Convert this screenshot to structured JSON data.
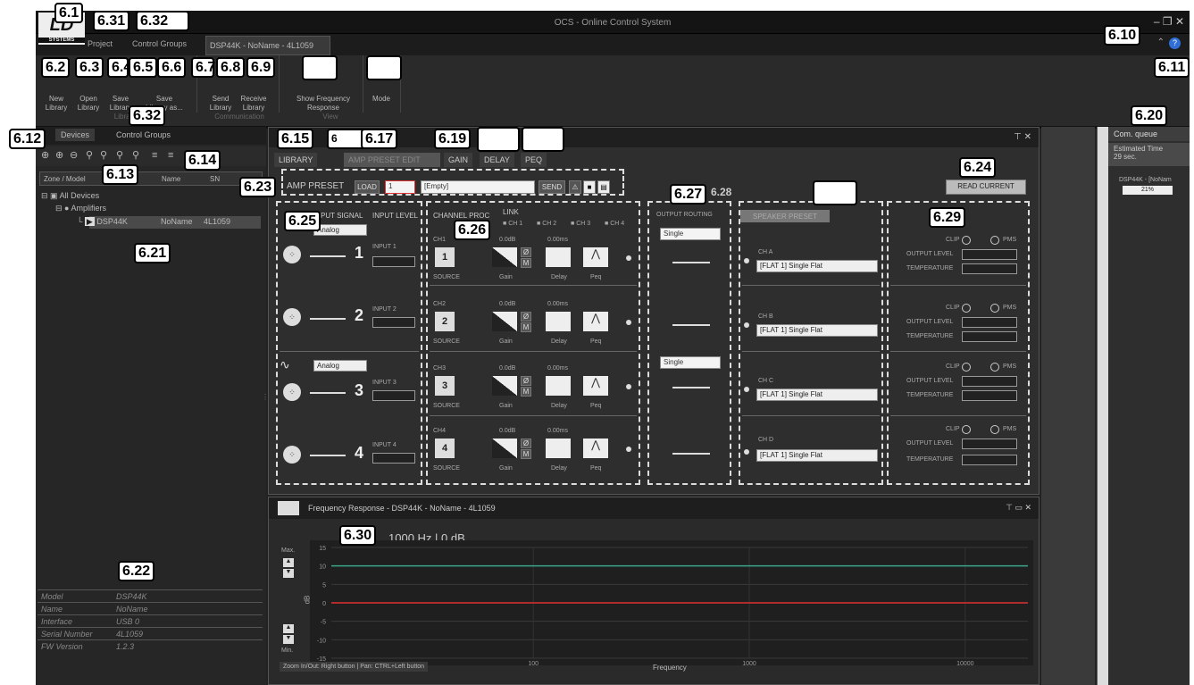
{
  "window": {
    "title": "OCS - Online Control System",
    "logo": "LD",
    "logo_sub": "SYSTEMS"
  },
  "menu": {
    "project": "Project",
    "control_groups": "Control Groups",
    "doc_tab": "DSP44K - NoName - 4L1059"
  },
  "ribbon": {
    "new_library": "New\nLibrary",
    "open_library": "Open\nLibrary",
    "save_library": "Save\nLibrary",
    "save_library_as": "Save\nLibrary as...",
    "send_library": "Send\nLibrary",
    "receive_library": "Receive\nLibrary",
    "show_freq": "Show Frequency\nResponse",
    "mode": "Mode",
    "group_library": "Library",
    "group_comm": "Communication",
    "group_view": "View"
  },
  "callouts": {
    "c61": "6.1",
    "c631": "6.31",
    "c632": "6.32",
    "c62": "6.2",
    "c63": "6.3",
    "c64": "6.4",
    "c65": "6.5",
    "c66": "6.6",
    "c67": "6.7",
    "c68": "6.8",
    "c69": "6.9",
    "c610": "6.10",
    "c611": "6.11",
    "c612": "6.12",
    "c613": "6.13",
    "c614": "6.14",
    "c632b": "6.32",
    "c615": "6.15",
    "c616": "6",
    "c617": "6.17",
    "c619": "6.19",
    "c620": "6.20",
    "c621": "6.21",
    "c622": "6.22",
    "c623": "6.23",
    "c624": "6.24",
    "c625": "6.25",
    "c626": "6.26",
    "c627": "6.27",
    "c628": "6.28",
    "c629": "6.29",
    "c630": "6.30"
  },
  "left": {
    "tab_devices": "Devices",
    "tab_control_groups": "Control Groups",
    "col_zone": "Zone / Model",
    "col_name": "Name",
    "col_sn": "SN",
    "tree_all": "All Devices",
    "tree_amps": "Amplifiers",
    "tree_dev_model": "DSP44K",
    "tree_dev_name": "NoName",
    "tree_dev_sn": "4L1059",
    "props": [
      {
        "k": "Model",
        "v": "DSP44K"
      },
      {
        "k": "Name",
        "v": "NoName"
      },
      {
        "k": "Interface",
        "v": "USB 0"
      },
      {
        "k": "Serial Number",
        "v": "4L1059"
      },
      {
        "k": "FW Version",
        "v": "1.2.3"
      }
    ]
  },
  "main": {
    "tabs": {
      "library": "LIBRARY",
      "amp_preset_edit": "AMP PRESET EDIT",
      "gain": "GAIN",
      "delay": "DELAY",
      "peq": "PEQ"
    },
    "amp_preset": "AMP PRESET",
    "load": "LOAD",
    "preset_num": "1",
    "preset_name": "[Empty]",
    "send": "SEND",
    "read_current": "READ CURRENT",
    "input_signal": "INPUT SIGNAL",
    "input_level": "INPUT LEVEL",
    "analog": "Analog",
    "inputs": [
      "INPUT 1",
      "INPUT 2",
      "INPUT 3",
      "INPUT 4"
    ],
    "channel_proc": "CHANNEL PROC",
    "link": "LINK",
    "link_items": [
      "CH 1",
      "CH 2",
      "CH 3",
      "CH 4"
    ],
    "channels": [
      {
        "name": "CH1",
        "num": "1",
        "gain": "0.0dB",
        "delay": "0.00ms"
      },
      {
        "name": "CH2",
        "num": "2",
        "gain": "0.0dB",
        "delay": "0.00ms"
      },
      {
        "name": "CH3",
        "num": "3",
        "gain": "0.0dB",
        "delay": "0.00ms"
      },
      {
        "name": "CH4",
        "num": "4",
        "gain": "0.0dB",
        "delay": "0.00ms"
      }
    ],
    "source": "SOURCE",
    "gain_lbl": "Gain",
    "delay_lbl": "Delay",
    "peq_lbl": "Peq",
    "phase": "Ø",
    "mute": "M",
    "output_routing": "OUTPUT ROUTING",
    "single": "Single",
    "speaker_preset": "SPEAKER PRESET",
    "outs": [
      {
        "ch": "CH A",
        "preset": "[FLAT 1] Single Flat"
      },
      {
        "ch": "CH B",
        "preset": "[FLAT 1] Single Flat"
      },
      {
        "ch": "CH C",
        "preset": "[FLAT 1] Single Flat"
      },
      {
        "ch": "CH D",
        "preset": "[FLAT 1] Single Flat"
      }
    ],
    "clip": "CLIP",
    "pms": "PMS",
    "output_level": "OUTPUT LEVEL",
    "temperature": "TEMPERATURE"
  },
  "freq": {
    "title": "Frequency Response - DSP44K - NoName - 4L1059",
    "readout": "1000 Hz | 0 dB",
    "max": "Max.",
    "min": "Min.",
    "db": "dB",
    "yticks": [
      "15",
      "10",
      "5",
      "0",
      "-5",
      "-10",
      "-15"
    ],
    "xticks": [
      "100",
      "1000",
      "10000"
    ],
    "xlabel": "Frequency",
    "hint": "Zoom In/Out: Right button | Pan: CTRL+Left button",
    "colors": {
      "green": "#3aa58a",
      "red": "#e03030"
    }
  },
  "right": {
    "title": "Com. queue",
    "est_time": "Estimated Time",
    "est_val": "29 sec.",
    "device": "DSP44K - [NoNam",
    "progress": "21%"
  }
}
